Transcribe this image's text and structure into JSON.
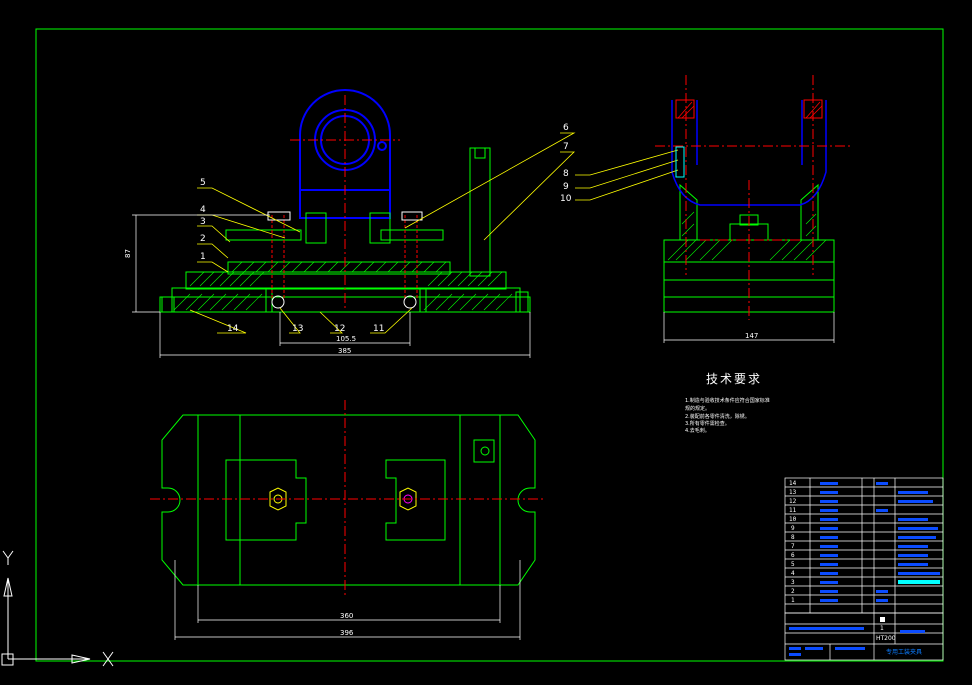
{
  "colors": {
    "background": "#000000",
    "frame": "#00ff00",
    "outline": "#00ff00",
    "center_line": "#ff0000",
    "hidden_part": "#0000ff",
    "leader": "#ffff00",
    "dimension": "#ffffff",
    "bom_text": "#0b7cff",
    "accent_cyan": "#00ffff"
  },
  "front_view": {
    "callouts": [
      "5",
      "4",
      "3",
      "2",
      "1",
      "14",
      "13",
      "12",
      "11"
    ],
    "dim_height": "87",
    "dim_inner": "105.5",
    "dim_overall": "385"
  },
  "side_view": {
    "callouts": [
      "6",
      "7",
      "8",
      "9",
      "10"
    ],
    "dim_width": "147"
  },
  "top_view": {
    "dim_inner": "360",
    "dim_overall": "396"
  },
  "tech_requirements": {
    "title": "技术要求",
    "lines": [
      "1.制造与验收技术条件应符合国家标准",
      "规的规定。",
      "2.装配前各零件清洗，除锈。",
      "3.所有零件需检查。",
      "4.去毛刺。"
    ]
  },
  "bom": {
    "numbers": [
      "14",
      "13",
      "12",
      "11",
      "10",
      "9",
      "8",
      "7",
      "6",
      "5",
      "4",
      "3",
      "2",
      "1"
    ]
  },
  "title_block": {
    "material": "HT200",
    "qty": "1",
    "name": "专用工装夹具"
  },
  "ucs": {
    "x_label": "X",
    "y_label": "Y"
  }
}
